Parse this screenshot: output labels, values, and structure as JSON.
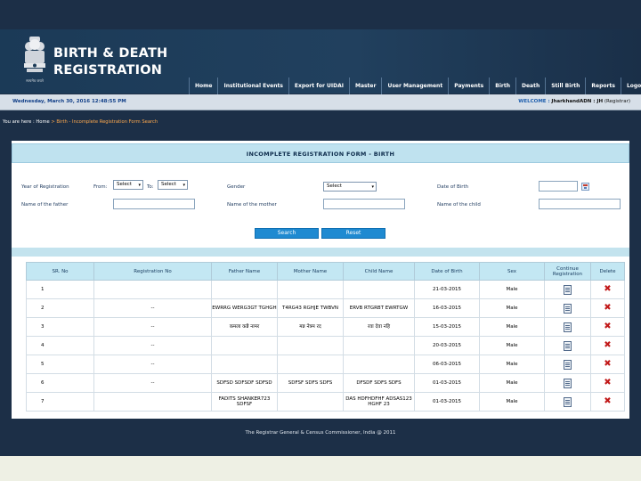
{
  "header": {
    "logo_line1": "BIRTH & DEATH",
    "logo_line2": "REGISTRATION",
    "emblem_caption": "सत्यमेव जयते",
    "nav": [
      "Home",
      "Institutional Events",
      "Export for UIDAI",
      "Master",
      "User Management",
      "Payments",
      "Birth",
      "Death",
      "Still Birth",
      "Reports",
      "Logout"
    ]
  },
  "infobar": {
    "date": "Wednesday, March 30, 2016 12:48:55 PM",
    "welcome_label": "WELCOME :",
    "user": "JharkhandADN : JH",
    "role": "(Registrar)"
  },
  "breadcrumb": {
    "prefix": "You are here :",
    "home": "Home",
    "separator": ">",
    "current": "Birth - Incomplete Registration Form Search"
  },
  "form": {
    "title": "INCOMPLETE REGISTRATION FORM - BIRTH",
    "year_label": "Year of Registration",
    "from_label": "From:",
    "to_label": "To:",
    "from_value": "Select",
    "to_value": "Select",
    "gender_label": "Gender",
    "gender_value": "Select",
    "dob_label": "Date of Birth",
    "father_label": "Name of the father",
    "mother_label": "Name of the mother",
    "child_label": "Name of the child",
    "search_label": "Search",
    "reset_label": "Reset"
  },
  "table": {
    "headers": [
      "SR. No",
      "Registration No",
      "Father Name",
      "Mother Name",
      "Child Name",
      "Date of Birth",
      "Sex",
      "Continue Registration",
      "Delete"
    ],
    "rows": [
      {
        "sr": "1",
        "reg": "",
        "father": "",
        "mother": "",
        "child": "",
        "dob": "21-03-2015",
        "sex": "Male"
      },
      {
        "sr": "2",
        "reg": "--",
        "father": "EWRRG WERG3GT TGHGH",
        "mother": "T4RG43 RGHJE TWBVN",
        "child": "ERVB RTGRBT EWRTGW",
        "dob": "16-03-2015",
        "sex": "Male"
      },
      {
        "sr": "3",
        "reg": "--",
        "father": "कमला कन्नै नामर",
        "mother": "मन्न नेत्रम रद",
        "child": "रवा देवा नहि",
        "dob": "15-03-2015",
        "sex": "Male"
      },
      {
        "sr": "4",
        "reg": "--",
        "father": "",
        "mother": "",
        "child": "",
        "dob": "20-03-2015",
        "sex": "Male"
      },
      {
        "sr": "5",
        "reg": "--",
        "father": "",
        "mother": "",
        "child": "",
        "dob": "06-03-2015",
        "sex": "Male"
      },
      {
        "sr": "6",
        "reg": "--",
        "father": "SDFSD SDFSDF SDFSD",
        "mother": "SDFSF SDFS SDFS",
        "child": "DFSDF SDFS SDFS",
        "dob": "01-03-2015",
        "sex": "Male"
      },
      {
        "sr": "7",
        "reg": "",
        "father": "FADITS SHANKER723 SDFSF",
        "mother": "",
        "child": "DAS HDFHDFHF ADSAS123 HGHF 23",
        "dob": "01-03-2015",
        "sex": "Male"
      }
    ]
  },
  "footer": {
    "text": "The Registrar General & Census Commissioner, India @ 2011"
  },
  "colors": {
    "page_bg": "#1c2f47",
    "header_bg": "#1b3a57",
    "panel_title_bg": "#bfe2ef",
    "button_bg": "#1f8ad1",
    "delete_red": "#c21a1a",
    "breadcrumb_accent": "#ffa94d"
  },
  "icons": {
    "continue": "document-icon",
    "delete": "delete-x-icon",
    "calendar": "calendar-icon",
    "emblem": "national-emblem-icon"
  }
}
